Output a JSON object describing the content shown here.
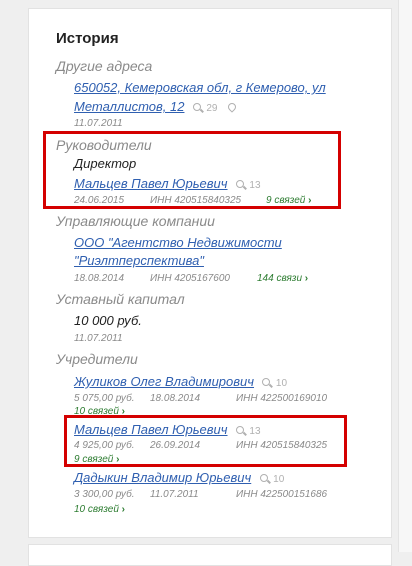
{
  "title": "История",
  "other_addresses": {
    "heading": "Другие адреса",
    "line1": "650052, Кемеровская обл, г Кемерово, ул",
    "line2": "Металлистов, 12",
    "count": "29",
    "date": "11.07.2011"
  },
  "leaders": {
    "heading": "Руководители",
    "role": "Директор",
    "name": "Мальцев Павел Юрьевич",
    "count": "13",
    "date": "24.06.2015",
    "inn": "ИНН 420515840325",
    "links": "9 связей"
  },
  "managers": {
    "heading": "Управляющие компании",
    "line1": "ООО \"Агентство Недвижимости",
    "line2": "\"Риэлтперспектива\"",
    "date": "18.08.2014",
    "inn": "ИНН 4205167600",
    "links": "144 связи"
  },
  "capital": {
    "heading": "Уставный капитал",
    "value": "10 000 руб.",
    "date": "11.07.2011"
  },
  "founders": {
    "heading": "Учредители",
    "items": [
      {
        "name": "Жуликов Олег Владимирович",
        "count": "10",
        "amount": "5 075,00 руб.",
        "date": "18.08.2014",
        "inn": "ИНН 422500169010",
        "links": "10 связей"
      },
      {
        "name": "Мальцев Павел Юрьевич",
        "count": "13",
        "amount": "4 925,00 руб.",
        "date": "26.09.2014",
        "inn": "ИНН 420515840325",
        "links": "9 связей"
      },
      {
        "name": "Дадыкин Владимир Юрьевич",
        "count": "10",
        "amount": "3 300,00 руб.",
        "date": "11.07.2011",
        "inn": "ИНН 422500151686",
        "links": "10 связей"
      }
    ]
  },
  "colors": {
    "link": "#2f5fb0",
    "green": "#2e7d32",
    "highlight": "#d40000"
  }
}
